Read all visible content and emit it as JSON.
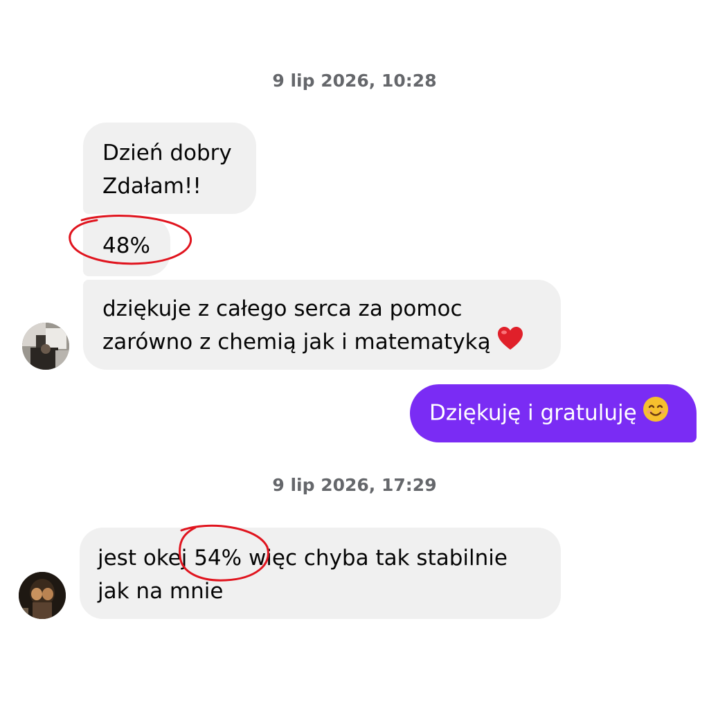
{
  "conversation": {
    "timestamp_1": "9 lip 2026, 10:28",
    "timestamp_2": "9 lip 2026, 17:29",
    "messages": [
      {
        "direction": "incoming",
        "lines": [
          "Dzień dobry",
          "Zdałam!!"
        ]
      },
      {
        "direction": "incoming",
        "lines": [
          "48%"
        ]
      },
      {
        "direction": "incoming",
        "lines": [
          "dziękuje z całego serca za pomoc",
          "zarówno z chemią jak i matematyką"
        ],
        "emoji": "heart-emoji"
      },
      {
        "direction": "outgoing",
        "lines": [
          "Dziękuję i gratuluję"
        ],
        "emoji": "smiling-face-emoji"
      },
      {
        "direction": "incoming",
        "lines": [
          "jest okej 54% więc chyba tak stabilnie",
          "jak na mnie"
        ]
      }
    ]
  },
  "colors": {
    "incoming_bubble": "#f0f0f0",
    "outgoing_bubble": "#7a2cf4",
    "annotation": "#e0141e",
    "timestamp_text": "#65676b"
  },
  "annotations": [
    "circle around 48%",
    "circle around 54%"
  ]
}
